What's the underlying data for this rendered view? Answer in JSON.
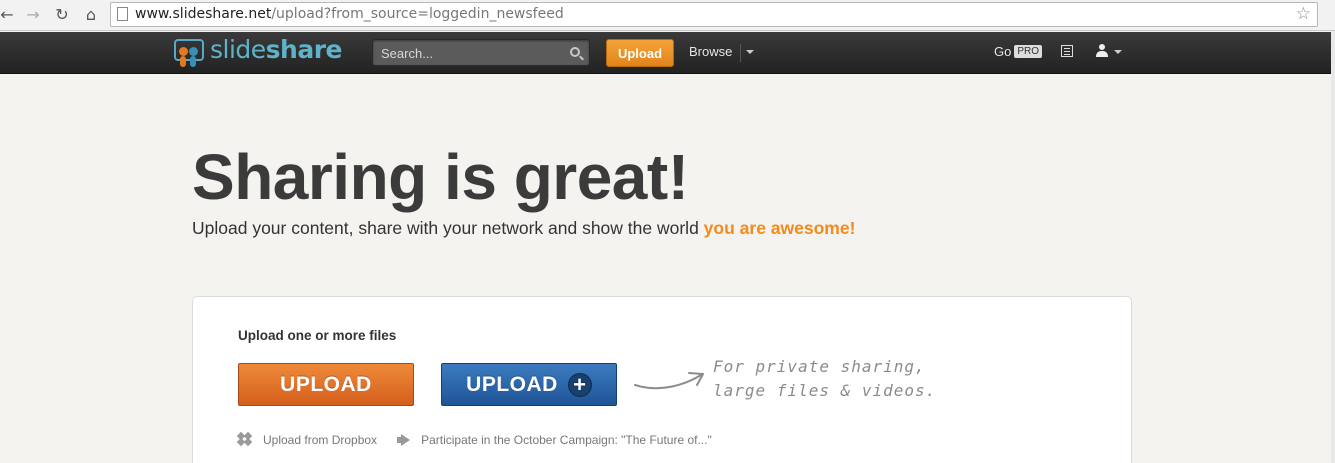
{
  "browser": {
    "url_host": "www.slideshare.net",
    "url_path": "/upload?from_source=loggedin_newsfeed",
    "back_glyph": "←",
    "forward_glyph": "→",
    "reload_glyph": "↻",
    "home_glyph": "⌂",
    "star_glyph": "☆"
  },
  "header": {
    "logo_slide": "slide",
    "logo_share": "share",
    "search_placeholder": "Search...",
    "upload_label": "Upload",
    "browse_label": "Browse",
    "go_label": "Go",
    "pro_label": "PRO"
  },
  "hero": {
    "title": "Sharing is great!",
    "subtitle_prefix": "Upload your content, share with your network and show the world ",
    "subtitle_accent": "you are awesome!"
  },
  "card": {
    "title": "Upload one or more files",
    "upload_label": "UPLOAD",
    "upload_plus_label": "UPLOAD",
    "plus_glyph": "+",
    "note_line1": "For private sharing,",
    "note_line2": "large files & videos.",
    "dropbox_label": "Upload from Dropbox",
    "campaign_label": "Participate in the October Campaign: \"The Future of...\""
  },
  "colors": {
    "accent_orange": "#f28a1c",
    "upload_blue": "#2a62a8",
    "header_dark": "#2a2a2a",
    "logo_blue": "#5fb3c9"
  }
}
